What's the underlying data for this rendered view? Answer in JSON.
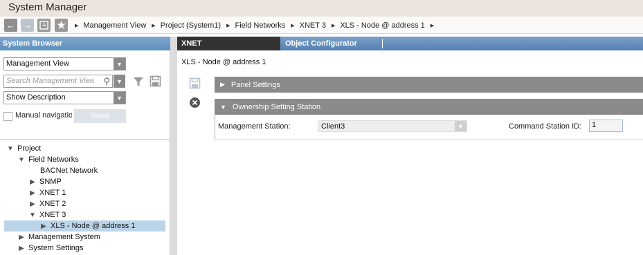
{
  "app": {
    "title": "System Manager"
  },
  "navigation": {
    "buttons": {
      "back": "back-arrow",
      "forward": "forward-arrow",
      "history": "history",
      "favorites": "star"
    },
    "breadcrumbs": [
      "Management View",
      "Project (System1)",
      "Field Networks",
      "XNET 3",
      "XLS - Node @ address 1"
    ]
  },
  "system_browser": {
    "header": "System Browser",
    "view_select": "Management View",
    "search_placeholder": "Search Management View",
    "description_select": "Show Description",
    "manual_navigation_label": "Manual navigatio",
    "send_label": "Send",
    "tree": [
      {
        "label": "Project",
        "level": 0,
        "expanded": true,
        "has_children": true
      },
      {
        "label": "Field Networks",
        "level": 1,
        "expanded": true,
        "has_children": true
      },
      {
        "label": "BACNet Network",
        "level": 2,
        "expanded": false,
        "has_children": false
      },
      {
        "label": "SNMP",
        "level": 2,
        "expanded": false,
        "has_children": true
      },
      {
        "label": "XNET 1",
        "level": 2,
        "expanded": false,
        "has_children": true
      },
      {
        "label": "XNET 2",
        "level": 2,
        "expanded": false,
        "has_children": true
      },
      {
        "label": "XNET 3",
        "level": 2,
        "expanded": true,
        "has_children": true
      },
      {
        "label": "XLS - Node @ address 1",
        "level": 3,
        "expanded": false,
        "has_children": true,
        "selected": true
      },
      {
        "label": "Management System",
        "level": 1,
        "expanded": false,
        "has_children": true
      },
      {
        "label": "System Settings",
        "level": 1,
        "expanded": false,
        "has_children": true
      }
    ]
  },
  "tabs": {
    "active": "XNET",
    "second": "Object Configurator"
  },
  "object": {
    "title": "XLS - Node @ address 1",
    "sections": {
      "panel_settings": "Panel Settings",
      "ownership": "Ownership Setting Station"
    },
    "fields": {
      "management_station_label": "Management Station:",
      "management_station_value": "Client3",
      "command_station_label": "Command Station ID:",
      "command_station_value": "1"
    }
  },
  "colors": {
    "accent": "#5f8fbd",
    "selection": "#bcd4e8",
    "section_header": "#8a8a8a",
    "tab_active": "#333333"
  }
}
